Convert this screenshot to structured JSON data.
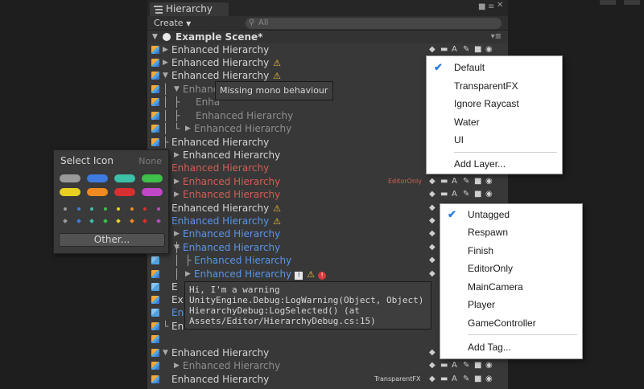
{
  "window": {
    "tab_title": "Hierarchy",
    "create_label": "Create",
    "search_placeholder": "All",
    "scene_title": "Example Scene*"
  },
  "rows": [
    {
      "label": "Enhanced Hierarchy",
      "color": "white",
      "arrow": "right"
    },
    {
      "label": "Enhanced Hierarchy",
      "color": "white",
      "arrow": "right",
      "warn": true
    },
    {
      "label": "Enhanced Hierarchy",
      "color": "white",
      "arrow": "down",
      "warn": true
    },
    {
      "label": "Enhanc",
      "color": "gray",
      "arrow": "down"
    },
    {
      "label": "Enha",
      "color": "gray"
    },
    {
      "label": "Enhanced Hierarchy",
      "color": "gray"
    },
    {
      "label": "Enhanced Hierarchy",
      "color": "gray",
      "arrow": "right"
    },
    {
      "label": "Enhanced Hierarchy",
      "color": "white"
    },
    {
      "label": "Enhanced Hierarchy",
      "color": "white",
      "arrow": "right"
    },
    {
      "label": "Enhanced Hierarchy",
      "color": "red"
    },
    {
      "label": "Enhanced Hierarchy",
      "color": "red",
      "arrow": "right",
      "right_label": "EditorOnly"
    },
    {
      "label": "Enhanced Hierarchy",
      "color": "red",
      "arrow": "right"
    },
    {
      "label": "Enhanced Hierarchy",
      "color": "white",
      "warn": true
    },
    {
      "label": "Enhanced Hierarchy",
      "color": "blue",
      "warn": true
    },
    {
      "label": "Enhanced Hierarchy",
      "color": "blue",
      "arrow": "right"
    },
    {
      "label": "Enhanced Hierarchy",
      "color": "blue",
      "arrow": "down"
    },
    {
      "label": "Enhanced Hierarchy",
      "color": "blue"
    },
    {
      "label": "Enhanced Hierarchy",
      "color": "blue",
      "arrow": "right",
      "info": true,
      "warn": true,
      "error": true
    },
    {
      "label": "E",
      "color": "white"
    },
    {
      "label": "Ex",
      "color": "white"
    },
    {
      "label": "En",
      "color": "blue"
    },
    {
      "label": "Enl",
      "color": "white"
    },
    {
      "label": "",
      "color": "white"
    },
    {
      "label": "Enhanced Hierarchy",
      "color": "white",
      "arrow": "down"
    },
    {
      "label": "Enhanced Hierarchy",
      "color": "gray",
      "arrow": "right"
    },
    {
      "label": "Enhanced Hierarchy",
      "color": "white",
      "right_label": "TransparentFX"
    }
  ],
  "tooltip_missing": "Missing mono behaviour",
  "tooltip_warning": [
    "Hi, I'm a warning",
    "UnityEngine.Debug:LogWarning(Object, Object)",
    "HierarchyDebug:LogSelected() (at",
    "Assets/Editor/HierarchyDebug.cs:15)"
  ],
  "layer_menu": {
    "items": [
      "Default",
      "TransparentFX",
      "Ignore Raycast",
      "Water",
      "UI"
    ],
    "checked": "Default",
    "add": "Add Layer..."
  },
  "tag_menu": {
    "items": [
      "Untagged",
      "Respawn",
      "Finish",
      "EditorOnly",
      "MainCamera",
      "Player",
      "GameController"
    ],
    "checked": "Untagged",
    "add": "Add Tag..."
  },
  "icon_panel": {
    "title": "Select Icon",
    "none": "None",
    "other": "Other...",
    "colors": [
      "#9a9a9a",
      "#3d7be0",
      "#3cc0a8",
      "#3ec04a",
      "#e8d020",
      "#ee8a20",
      "#d83030",
      "#c048c8"
    ]
  }
}
